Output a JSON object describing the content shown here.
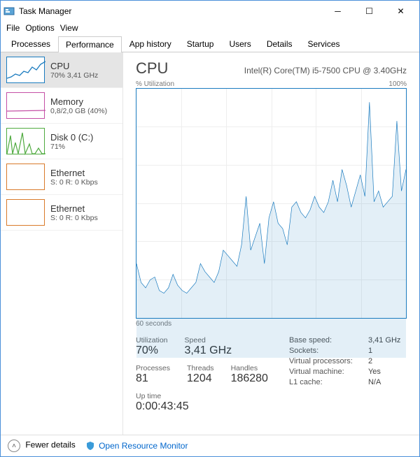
{
  "window": {
    "title": "Task Manager"
  },
  "menu": {
    "file": "File",
    "options": "Options",
    "view": "View"
  },
  "tabs": {
    "processes": "Processes",
    "performance": "Performance",
    "app_history": "App history",
    "startup": "Startup",
    "users": "Users",
    "details": "Details",
    "services": "Services"
  },
  "sidebar": {
    "items": [
      {
        "title": "CPU",
        "sub": "70% 3,41 GHz",
        "color": "#1a7bbf"
      },
      {
        "title": "Memory",
        "sub": "0,8/2,0 GB (40%)",
        "color": "#c44fa6"
      },
      {
        "title": "Disk 0 (C:)",
        "sub": "71%",
        "color": "#4faa3f"
      },
      {
        "title": "Ethernet",
        "sub": "S: 0  R: 0 Kbps",
        "color": "#d97a2a"
      },
      {
        "title": "Ethernet",
        "sub": "S: 0  R: 0 Kbps",
        "color": "#d97a2a"
      }
    ]
  },
  "main": {
    "title": "CPU",
    "subtitle": "Intel(R) Core(TM) i5-7500 CPU @ 3.40GHz",
    "axis_left": "% Utilization",
    "axis_right": "100%",
    "time_label": "60 seconds",
    "stats": {
      "utilization_label": "Utilization",
      "utilization_value": "70%",
      "speed_label": "Speed",
      "speed_value": "3,41 GHz",
      "processes_label": "Processes",
      "processes_value": "81",
      "threads_label": "Threads",
      "threads_value": "1204",
      "handles_label": "Handles",
      "handles_value": "186280",
      "uptime_label": "Up time",
      "uptime_value": "0:00:43:45"
    },
    "kv": [
      {
        "k": "Base speed:",
        "v": "3,41 GHz"
      },
      {
        "k": "Sockets:",
        "v": "1"
      },
      {
        "k": "Virtual processors:",
        "v": "2"
      },
      {
        "k": "Virtual machine:",
        "v": "Yes"
      },
      {
        "k": "L1 cache:",
        "v": "N/A"
      }
    ]
  },
  "footer": {
    "fewer": "Fewer details",
    "monitor": "Open Resource Monitor"
  },
  "chart_data": {
    "type": "line",
    "title": "CPU % Utilization",
    "xlabel": "60 seconds",
    "ylabel": "% Utilization",
    "ylim": [
      0,
      100
    ],
    "x": [
      0,
      1,
      2,
      3,
      4,
      5,
      6,
      7,
      8,
      9,
      10,
      11,
      12,
      13,
      14,
      15,
      16,
      17,
      18,
      19,
      20,
      21,
      22,
      23,
      24,
      25,
      26,
      27,
      28,
      29,
      30,
      31,
      32,
      33,
      34,
      35,
      36,
      37,
      38,
      39,
      40,
      41,
      42,
      43,
      44,
      45,
      46,
      47,
      48,
      49,
      50,
      51,
      52,
      53,
      54,
      55,
      56,
      57,
      58,
      59
    ],
    "values": [
      35,
      28,
      26,
      29,
      30,
      25,
      24,
      26,
      31,
      27,
      25,
      24,
      26,
      28,
      35,
      32,
      30,
      28,
      32,
      40,
      38,
      36,
      34,
      42,
      60,
      40,
      45,
      50,
      35,
      52,
      58,
      50,
      48,
      42,
      56,
      58,
      54,
      52,
      55,
      60,
      56,
      54,
      58,
      66,
      58,
      70,
      64,
      56,
      62,
      68,
      60,
      95,
      58,
      62,
      56,
      58,
      60,
      88,
      62,
      70
    ]
  }
}
